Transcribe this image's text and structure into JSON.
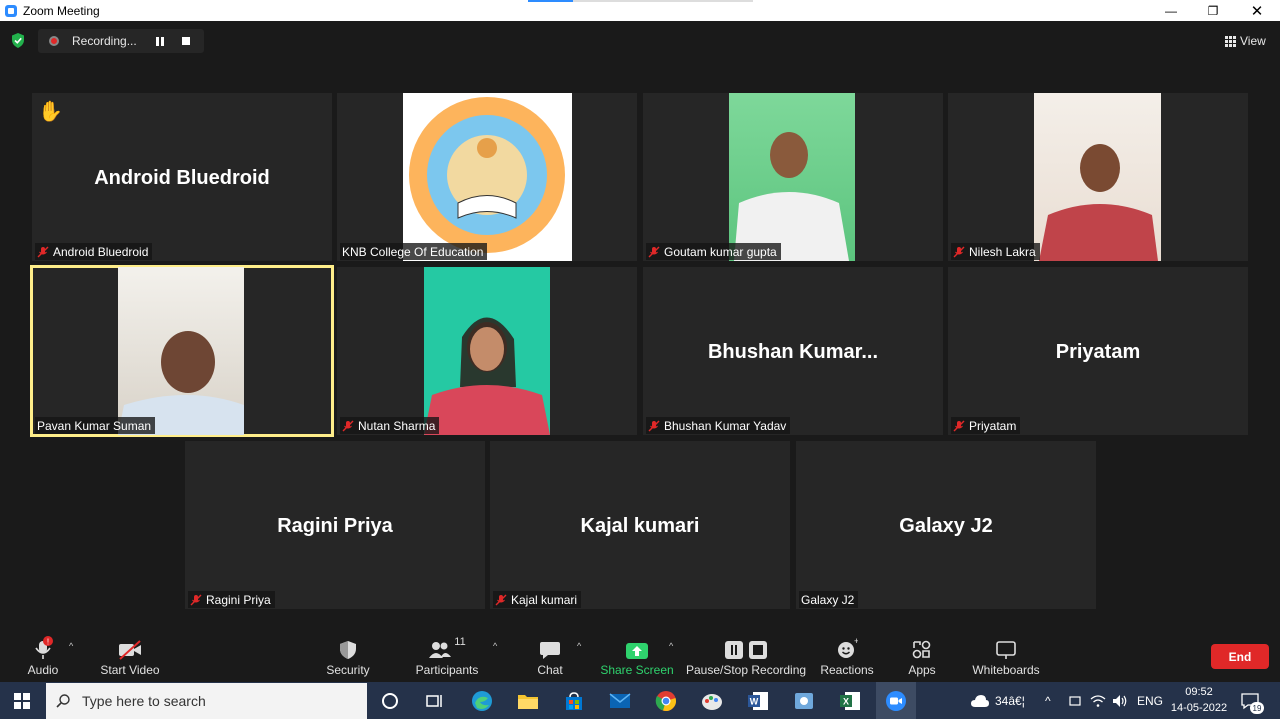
{
  "window": {
    "title": "Zoom Meeting"
  },
  "recording": {
    "label": "Recording..."
  },
  "view": {
    "label": "View"
  },
  "tiles": [
    {
      "big_name": "Android Bluedroid",
      "label": "Android Bluedroid",
      "muted": true,
      "hand_raised": true
    },
    {
      "big_name": "",
      "label": "KNB College Of Education",
      "muted": false
    },
    {
      "big_name": "",
      "label": "Goutam kumar gupta",
      "muted": true
    },
    {
      "big_name": "",
      "label": "Nilesh Lakra",
      "muted": true
    },
    {
      "big_name": "",
      "label": "Pavan Kumar Suman",
      "muted": false,
      "active_speaker": true
    },
    {
      "big_name": "",
      "label": "Nutan Sharma",
      "muted": true
    },
    {
      "big_name": "Bhushan  Kumar...",
      "label": "Bhushan Kumar Yadav",
      "muted": true
    },
    {
      "big_name": "Priyatam",
      "label": "Priyatam",
      "muted": true
    },
    {
      "big_name": "Ragini Priya",
      "label": "Ragini Priya",
      "muted": true
    },
    {
      "big_name": "Kajal kumari",
      "label": "Kajal kumari",
      "muted": true
    },
    {
      "big_name": "Galaxy J2",
      "label": "Galaxy J2",
      "muted": false
    }
  ],
  "toolbar": {
    "audio": "Audio",
    "start_video": "Start Video",
    "security": "Security",
    "participants": "Participants",
    "participants_count": "11",
    "chat": "Chat",
    "share_screen": "Share Screen",
    "pause_stop_recording": "Pause/Stop Recording",
    "reactions": "Reactions",
    "apps": "Apps",
    "whiteboards": "Whiteboards",
    "end": "End"
  },
  "taskbar": {
    "search_placeholder": "Type here to search",
    "weather": "34â€¦",
    "language": "ENG",
    "time": "09:52",
    "date": "14-05-2022",
    "notifications": "19"
  },
  "colors": {
    "accent": "#2d8cff",
    "share_green": "#2fd26d",
    "end_red": "#e02828",
    "active_border": "#ffee8a"
  }
}
